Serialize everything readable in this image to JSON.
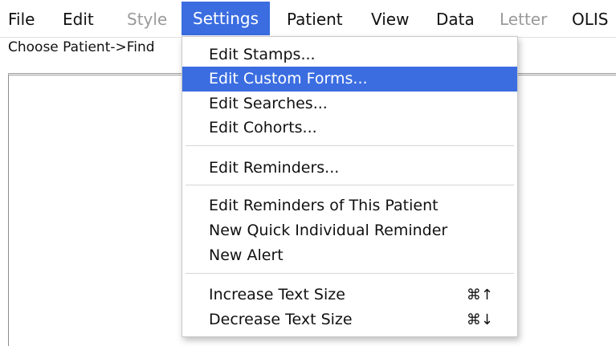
{
  "menubar": {
    "items": [
      {
        "label": "File",
        "enabled": true
      },
      {
        "label": "Edit",
        "enabled": true
      },
      {
        "label": "Style",
        "enabled": false
      },
      {
        "label": "Settings",
        "enabled": true,
        "active": true
      },
      {
        "label": "Patient",
        "enabled": true
      },
      {
        "label": "View",
        "enabled": true
      },
      {
        "label": "Data",
        "enabled": true
      },
      {
        "label": "Letter",
        "enabled": false
      },
      {
        "label": "OLIS",
        "enabled": true
      }
    ]
  },
  "status": {
    "text": "Choose Patient->Find"
  },
  "settings_menu": {
    "items": [
      {
        "label": "Edit Stamps...",
        "shortcut": ""
      },
      {
        "label": "Edit Custom Forms...",
        "shortcut": "",
        "selected": true
      },
      {
        "label": "Edit Searches...",
        "shortcut": ""
      },
      {
        "label": "Edit Cohorts...",
        "shortcut": ""
      },
      {
        "label": "Edit Reminders...",
        "shortcut": ""
      },
      {
        "label": "Edit Reminders of This Patient",
        "shortcut": ""
      },
      {
        "label": "New Quick Individual Reminder",
        "shortcut": ""
      },
      {
        "label": "New Alert",
        "shortcut": ""
      },
      {
        "label": "Increase Text Size",
        "shortcut": "⌘↑"
      },
      {
        "label": "Decrease Text Size",
        "shortcut": "⌘↓"
      }
    ]
  },
  "colors": {
    "highlight": "#3b6de1",
    "disabled_text": "#9a9a9a"
  }
}
